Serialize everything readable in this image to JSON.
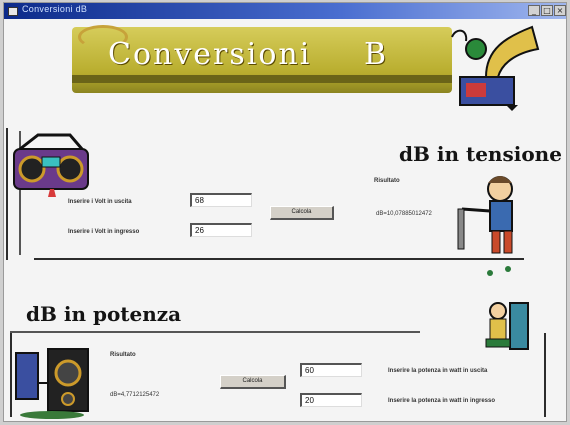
{
  "window": {
    "title": "Conversioni dB",
    "buttons": {
      "minimize": "_",
      "maximize": "□",
      "close": "×"
    }
  },
  "banner": {
    "title": "Conversioni",
    "unit": "B"
  },
  "tension": {
    "heading": "dB in tensione",
    "input_label_1": "Inserire i Volt in uscita",
    "input_value_1": "68",
    "input_label_2": "Inserire i Volt in ingresso",
    "input_value_2": "26",
    "button_label": "Calcola",
    "result_label": "Risultato",
    "result_value": "dB=10,07885012472"
  },
  "power": {
    "heading": "dB in potenza",
    "result_label": "Risultato",
    "result_value": "dB=4,7712125472",
    "button_label": "Calcola",
    "input_value_1": "60",
    "input_label_1": "Inserire la potenza in watt in uscita",
    "input_value_2": "20",
    "input_label_2": "Inserire la potenza in watt in ingresso"
  },
  "colors": {
    "banner": "#b8ad2e",
    "titlebar": "#0c2a8a",
    "background": "#f4f4f4"
  }
}
